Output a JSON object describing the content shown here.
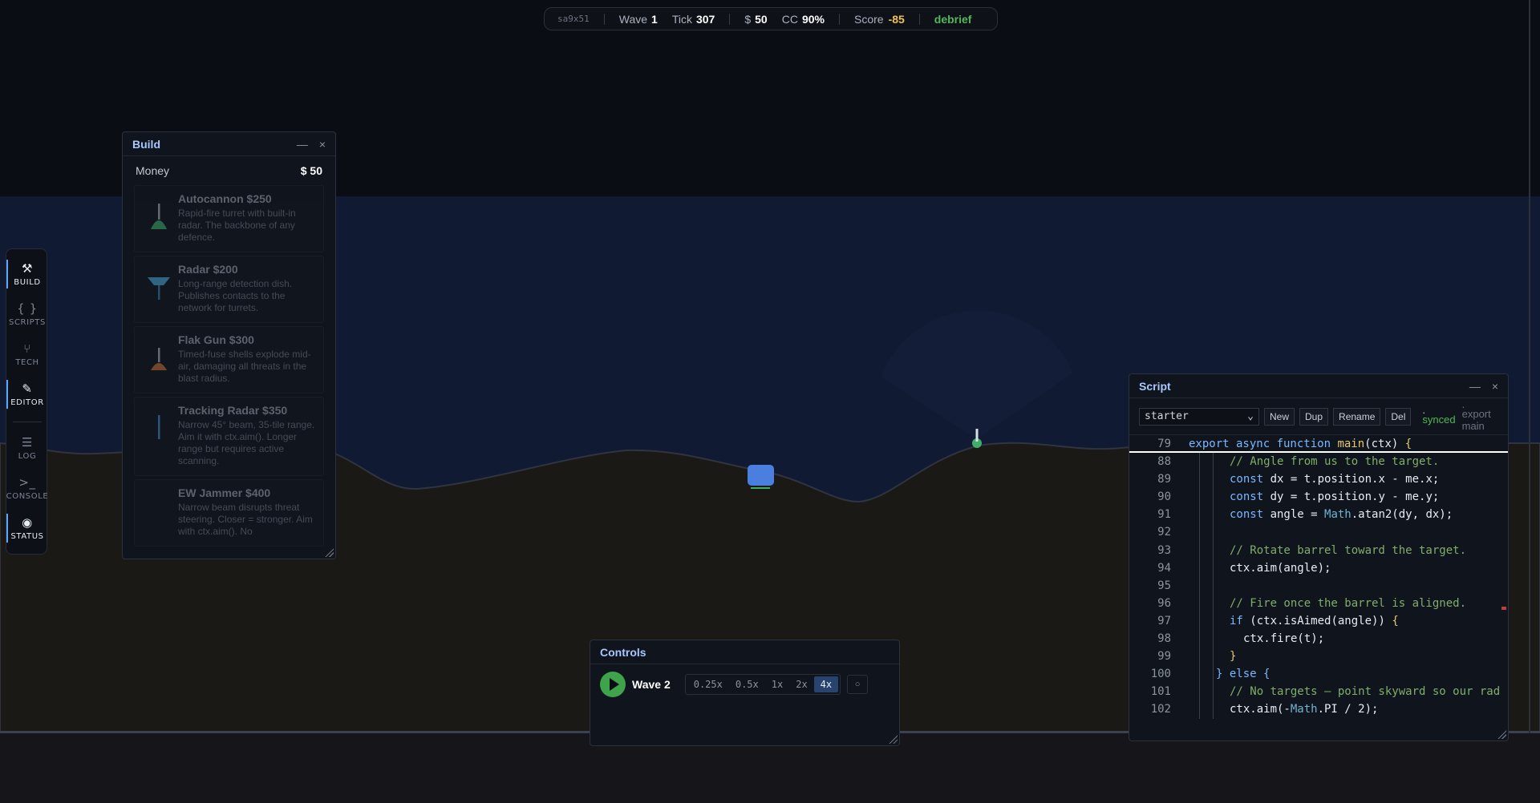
{
  "hud": {
    "session": "sa9x51",
    "wave_label": "Wave",
    "wave_value": "1",
    "tick_label": "Tick",
    "tick_value": "307",
    "money_label": "$",
    "money_value": "50",
    "cc_label": "CC",
    "cc_value": "90%",
    "score_label": "Score",
    "score_value": "-85",
    "debrief_label": "debrief"
  },
  "rail": {
    "items": [
      {
        "label": "BUILD",
        "icon": "hammer-icon",
        "glyph": "⚒",
        "active": true
      },
      {
        "label": "SCRIPTS",
        "icon": "braces-icon",
        "glyph": "{ }",
        "active": false
      },
      {
        "label": "TECH",
        "icon": "tech-tree-icon",
        "glyph": "⑂",
        "active": false
      },
      {
        "label": "EDITOR",
        "icon": "pencil-icon",
        "glyph": "✎",
        "active": true
      },
      {
        "label": "LOG",
        "icon": "list-icon",
        "glyph": "☰",
        "active": false
      },
      {
        "label": "CONSOLE",
        "icon": "terminal-icon",
        "glyph": ">_",
        "active": false
      },
      {
        "label": "STATUS",
        "icon": "eye-icon",
        "glyph": "◉",
        "active": true
      }
    ]
  },
  "build": {
    "title": "Build",
    "minimize": "—",
    "close": "×",
    "money_label": "Money",
    "money_value": "$ 50",
    "items": [
      {
        "name": "Autocannon $250",
        "desc": "Rapid-fire turret with built-in radar. The backbone of any defence.",
        "icon": "autocannon-icon"
      },
      {
        "name": "Radar $200",
        "desc": "Long-range detection dish. Publishes contacts to the network for turrets.",
        "icon": "radar-icon"
      },
      {
        "name": "Flak Gun $300",
        "desc": "Timed-fuse shells explode mid-air, damaging all threats in the blast radius.",
        "icon": "flak-gun-icon"
      },
      {
        "name": "Tracking Radar $350",
        "desc": "Narrow 45° beam, 35-tile range. Aim it with ctx.aim(). Longer range but requires active scanning.",
        "icon": "tracking-radar-icon"
      },
      {
        "name": "EW Jammer $400",
        "desc": "Narrow beam disrupts threat steering. Closer = stronger. Aim with ctx.aim(). No",
        "icon": "jammer-icon"
      }
    ]
  },
  "controls": {
    "title": "Controls",
    "wave_button": "Wave 2",
    "speeds": [
      "0.25x",
      "0.5x",
      "1x",
      "2x",
      "4x"
    ],
    "active_speed": "4x",
    "toggle": "○"
  },
  "script": {
    "title": "Script",
    "minimize": "—",
    "close": "×",
    "selected": "starter",
    "buttons": [
      "New",
      "Dup",
      "Rename",
      "Del"
    ],
    "status": "synced",
    "status_dot": ".",
    "export_hint_dot": ".",
    "export_hint": "export main",
    "lines": [
      {
        "n": "79",
        "indent": 0,
        "tokens": [
          [
            "kw",
            "export async function "
          ],
          [
            "fn",
            "main"
          ],
          [
            "",
            "(ctx) "
          ],
          [
            "fn",
            "{"
          ]
        ]
      },
      {
        "n": "88",
        "indent": 3,
        "tokens": [
          [
            "cm",
            "// Angle from us to the target."
          ]
        ]
      },
      {
        "n": "89",
        "indent": 3,
        "tokens": [
          [
            "kw",
            "const "
          ],
          [
            "",
            "dx = t.position.x - me.x;"
          ]
        ]
      },
      {
        "n": "90",
        "indent": 3,
        "tokens": [
          [
            "kw",
            "const "
          ],
          [
            "",
            "dy = t.position.y - me.y;"
          ]
        ]
      },
      {
        "n": "91",
        "indent": 3,
        "tokens": [
          [
            "kw",
            "const "
          ],
          [
            "",
            "angle = "
          ],
          [
            "ty",
            "Math"
          ],
          [
            "",
            ".atan2(dy, dx);"
          ]
        ]
      },
      {
        "n": "92",
        "indent": 3,
        "tokens": []
      },
      {
        "n": "93",
        "indent": 3,
        "tokens": [
          [
            "cm",
            "// Rotate barrel toward the target."
          ]
        ]
      },
      {
        "n": "94",
        "indent": 3,
        "tokens": [
          [
            "",
            "ctx.aim(angle);"
          ]
        ]
      },
      {
        "n": "95",
        "indent": 3,
        "tokens": []
      },
      {
        "n": "96",
        "indent": 3,
        "tokens": [
          [
            "cm",
            "// Fire once the barrel is aligned."
          ]
        ]
      },
      {
        "n": "97",
        "indent": 3,
        "tokens": [
          [
            "kw",
            "if "
          ],
          [
            "",
            "(ctx.isAimed(angle)) "
          ],
          [
            "fn",
            "{"
          ]
        ]
      },
      {
        "n": "98",
        "indent": 4,
        "tokens": [
          [
            "",
            "ctx.fire(t);"
          ]
        ]
      },
      {
        "n": "99",
        "indent": 3,
        "tokens": [
          [
            "fn",
            "}"
          ]
        ]
      },
      {
        "n": "100",
        "indent": 2,
        "tokens": [
          [
            "kw",
            "} else {"
          ]
        ]
      },
      {
        "n": "101",
        "indent": 3,
        "tokens": [
          [
            "cm",
            "// No targets — point skyward so our rad"
          ]
        ]
      },
      {
        "n": "102",
        "indent": 3,
        "tokens": [
          [
            "",
            "ctx.aim(-"
          ],
          [
            "ty",
            "Math"
          ],
          [
            "",
            ".PI / 2);"
          ]
        ]
      }
    ]
  },
  "colors": {
    "sky_top": "#0b0d14",
    "sky_band": "#111a33",
    "ground": "#1a1916",
    "accent_blue": "#58a6ff",
    "accent_green": "#4fb859",
    "score": "#f2c14e",
    "base": "#4a7fe0"
  }
}
